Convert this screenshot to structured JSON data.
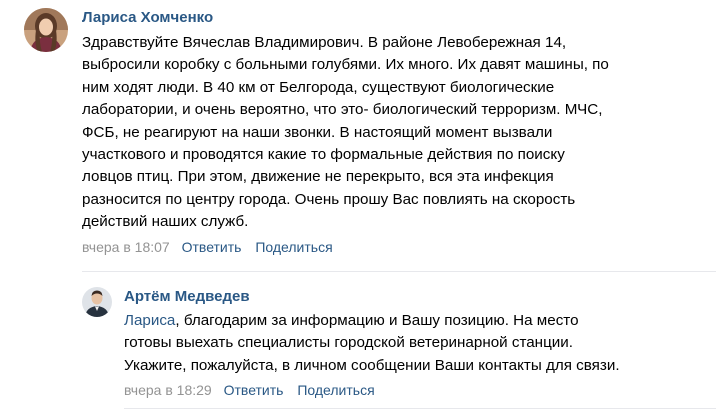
{
  "colors": {
    "author": "#2a5885",
    "link": "#2a5885",
    "meta": "#939393",
    "text": "#000000"
  },
  "comments": [
    {
      "author": "Лариса Хомченко",
      "avatar_icon": "user-avatar-photo",
      "text": "Здравствуйте Вячеслав Владимирович. В районе Левобережная 14,\nвыбросили коробку с больными голубями. Их много. Их давят машины, по\nним ходят люди. В 40 км от Белгорода, существуют биологические\nлаборатории, и очень вероятно, что это- биологический терроризм. МЧС,\nФСБ, не реагируют на наши звонки. В настоящий момент вызвали\nучасткового и проводятся какие то формальные действия по поиску\nловцов птиц. При этом, движение не перекрыто, вся эта инфекция\nразносится по центру города. Очень прошу Вас повлиять на скорость\nдействий наших служб.",
      "date": "вчера в 18:07",
      "reply": "Ответить",
      "share": "Поделиться"
    },
    {
      "author": "Артём Медведев",
      "avatar_icon": "user-avatar-photo",
      "reply_to": "Лариса",
      "text": ", благодарим за информацию и Вашу позицию. На место\nготовы выехать специалисты городской ветеринарной станции.\nУкажите, пожалуйста, в личном сообщении Ваши контакты для связи.",
      "date": "вчера в 18:29",
      "reply": "Ответить",
      "share": "Поделиться"
    }
  ]
}
